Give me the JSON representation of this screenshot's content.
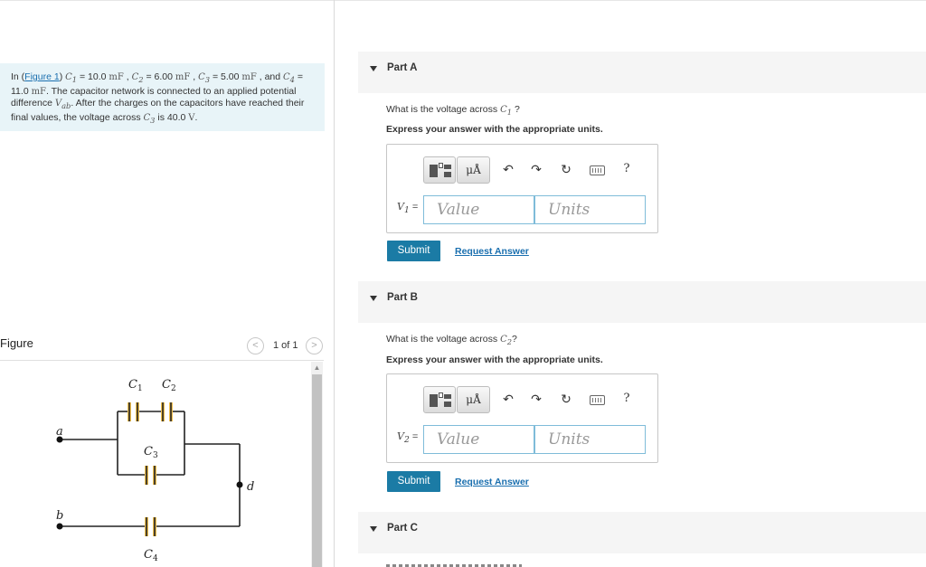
{
  "problem": {
    "intro": "In (",
    "figure_link": "Figure 1",
    "c1_sym": "C",
    "c1_sub": "1",
    "c1_val": " = 10.0 ",
    "c1_unit": "mF",
    "c2_sym": "C",
    "c2_sub": "2",
    "c2_val": " = 6.00 ",
    "c2_unit": "mF",
    "c3_sym": "C",
    "c3_sub": "3",
    "c3_val": " = 5.00 ",
    "c3_unit": "mF",
    "and": " , and",
    "c4_sym": "C",
    "c4_sub": "4",
    "c4_val": " = 11.0 ",
    "c4_unit": "mF",
    "text1": ". The capacitor network is connected to an applied potential difference ",
    "vab_sym": "V",
    "vab_sub": "ab",
    "text2": ". After the charges on the capacitors have reached their final values, the voltage across ",
    "c3b_sym": "C",
    "c3b_sub": "3",
    "text3": " is 40.0 ",
    "volt_unit": "V",
    "text4": "."
  },
  "figure": {
    "title": "Figure",
    "pager": "1 of 1",
    "prev_glyph": "<",
    "next_glyph": ">",
    "node_a": "a",
    "node_b": "b",
    "node_d": "d",
    "cap1_sym": "C",
    "cap1_sub": "1",
    "cap2_sym": "C",
    "cap2_sub": "2",
    "cap3_sym": "C",
    "cap3_sub": "3",
    "cap4_sym": "C",
    "cap4_sub": "4"
  },
  "parts": [
    {
      "title": "Part A",
      "q_pre": "What is the voltage across ",
      "q_sym": "C",
      "q_sub": "1",
      "q_post": " ?",
      "instruction": "Express your answer with the appropriate units.",
      "var_sym": "V",
      "var_sub": "1",
      "eq": " =",
      "value_placeholder": "Value",
      "units_placeholder": "Units",
      "submit": "Submit",
      "request": "Request Answer"
    },
    {
      "title": "Part B",
      "q_pre": "What is the voltage across ",
      "q_sym": "C",
      "q_sub": "2",
      "q_post": "?",
      "instruction": "Express your answer with the appropriate units.",
      "var_sym": "V",
      "var_sub": "2",
      "eq": " =",
      "value_placeholder": "Value",
      "units_placeholder": "Units",
      "submit": "Submit",
      "request": "Request Answer"
    },
    {
      "title": "Part C"
    }
  ],
  "toolbar": {
    "units_label": "μÅ",
    "help_label": "?",
    "icons": [
      "templates-icon",
      "units-icon",
      "undo-icon",
      "redo-icon",
      "reset-icon",
      "keyboard-icon",
      "help-icon"
    ]
  },
  "colors": {
    "accent": "#1b7ba5",
    "problem_bg": "#e8f4f8",
    "link": "#1a6faf",
    "capacitor": "#f2c14e"
  }
}
